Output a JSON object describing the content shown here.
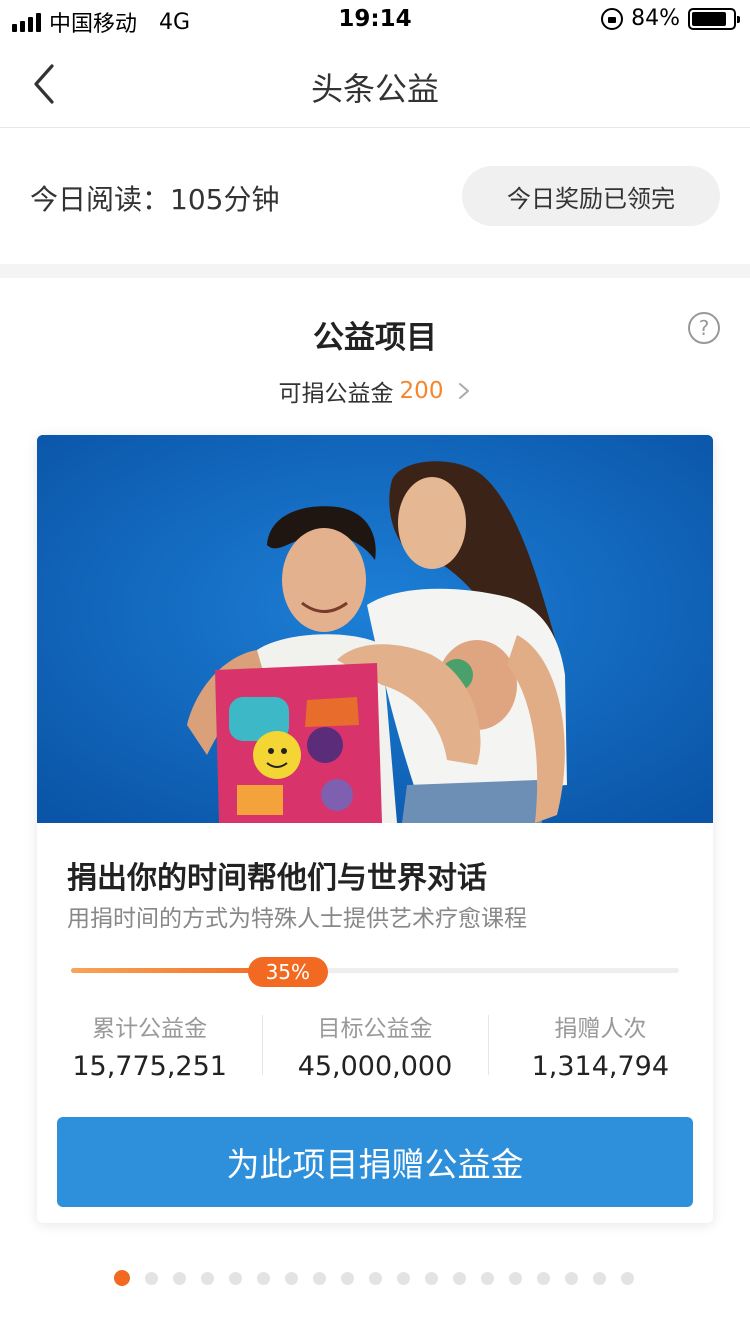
{
  "status_bar": {
    "carrier": "中国移动",
    "network": "4G",
    "time": "19:14",
    "battery_percent": "84%",
    "battery_level": 0.84,
    "icons": [
      "signal-icon",
      "rotation-lock-icon",
      "battery-icon"
    ]
  },
  "nav": {
    "title": "头条公益",
    "back_icon": "chevron-left-icon"
  },
  "reading": {
    "label": "今日阅读：105分钟",
    "reward_button": "今日奖励已领完"
  },
  "section": {
    "title": "公益项目",
    "help_glyph": "?",
    "donate_label": "可捐公益金",
    "donate_amount": "200"
  },
  "project": {
    "image_description_icon": "photo",
    "title": "捐出你的时间帮他们与世界对话",
    "subtitle": "用捐时间的方式为特殊人士提供艺术疗愈课程",
    "progress_label": "35%",
    "progress_value": 0.35,
    "stats": [
      {
        "label": "累计公益金",
        "value": "15,775,251"
      },
      {
        "label": "目标公益金",
        "value": "45,000,000"
      },
      {
        "label": "捐赠人次",
        "value": "1,314,794"
      }
    ],
    "cta": "为此项目捐赠公益金"
  },
  "pager": {
    "total": 19,
    "active_index": 0
  },
  "colors": {
    "accent_orange": "#f26a21",
    "primary_blue": "#2e8fdb",
    "photo_background": "#0c64bf"
  }
}
